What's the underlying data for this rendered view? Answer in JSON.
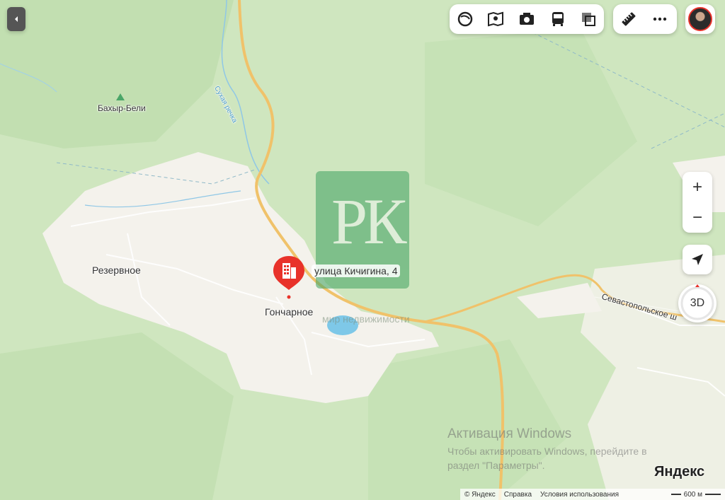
{
  "map": {
    "places": {
      "mountain": "Бахыр-Бели",
      "village_1": "Резервное",
      "village_2": "Гончарное",
      "river": "Сухая речка",
      "road": "Севастопольское ш",
      "faded_text": "мир недвижимости"
    },
    "pin": {
      "address": "улица Кичигина, 4",
      "color": "#e8322a",
      "icon": "building-icon"
    },
    "watermark_logo_text": "РК",
    "colors": {
      "forest": "#cfe6bf",
      "settlement": "#f4f2ec",
      "road_major": "#f0c26a",
      "water": "#7ec8e8",
      "logo_bg": "#4aa668"
    }
  },
  "toolbar": {
    "layers_icon": "layers-icon",
    "panorama_icon": "panorama-icon",
    "photo_icon": "camera-icon",
    "transit_icon": "bus-icon",
    "overlay_icon": "overlay-icon",
    "ruler_icon": "ruler-icon",
    "more_icon": "more-icon"
  },
  "controls": {
    "zoom_in": "+",
    "zoom_out": "−",
    "mode_3d": "3D"
  },
  "activation": {
    "title": "Активация Windows",
    "line1": "Чтобы активировать Windows, перейдите в",
    "line2": "раздел \"Параметры\"."
  },
  "brand": "Яндекс",
  "footer": {
    "copyright": "© Яндекс",
    "help": "Справка",
    "terms": "Условия использования",
    "scale": "600 м"
  }
}
